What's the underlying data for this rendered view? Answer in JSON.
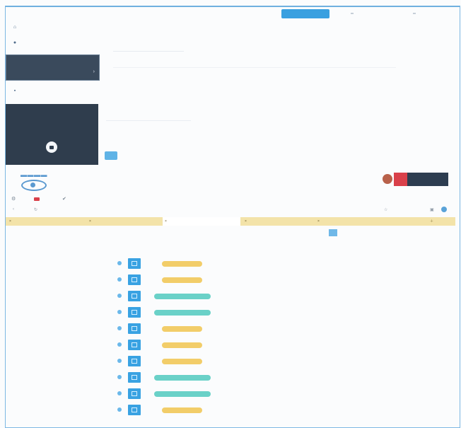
{
  "top_bar": {
    "action_label": ""
  },
  "sidebar": {
    "items": [
      {
        "label": "",
        "icon": "home-icon"
      },
      {
        "label": "",
        "icon": "dot-icon"
      },
      {
        "label": "",
        "icon": "square-icon"
      }
    ],
    "active_panel": {
      "line1": "",
      "line2": ""
    },
    "lock_panel": {
      "line1": "",
      "line2": "",
      "line3": ""
    }
  },
  "main": {
    "link_text": "",
    "heading_text": "",
    "zoom_text": ""
  },
  "browser": {
    "tabs": [
      {
        "label": ""
      },
      {
        "label": ""
      },
      {
        "label": ""
      },
      {
        "label": ""
      },
      {
        "label": ""
      }
    ]
  },
  "table": {
    "rows": [
      {
        "status": "yellow"
      },
      {
        "status": "yellow"
      },
      {
        "status": "teal"
      },
      {
        "status": "teal"
      },
      {
        "status": "yellow"
      },
      {
        "status": "yellow"
      },
      {
        "status": "yellow"
      },
      {
        "status": "teal"
      },
      {
        "status": "teal"
      },
      {
        "status": "yellow"
      }
    ]
  },
  "colors": {
    "accent": "#39a0e0",
    "dark_panel": "#2f3d4d",
    "pill_yellow": "#f2cd69",
    "pill_teal": "#6ad1c8",
    "tabbar": "#f3e3a9"
  }
}
